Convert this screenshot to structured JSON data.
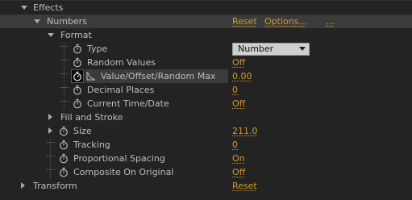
{
  "effects": {
    "label": "Effects",
    "numbers": {
      "label": "Numbers",
      "reset": "Reset",
      "options": "Options...",
      "more": "...",
      "format": {
        "label": "Format",
        "type": {
          "label": "Type",
          "value": "Number"
        },
        "random_values": {
          "label": "Random Values",
          "value": "Off"
        },
        "value_offset": {
          "label": "Value/Offset/Random Max",
          "value": "0.00"
        },
        "decimal_places": {
          "label": "Decimal Places",
          "value": "0"
        },
        "current_time": {
          "label": "Current Time/Date",
          "value": "Off"
        }
      },
      "fill_and_stroke": {
        "label": "Fill and Stroke"
      },
      "size": {
        "label": "Size",
        "value": "211.0"
      },
      "tracking": {
        "label": "Tracking",
        "value": "0"
      },
      "proportional_spacing": {
        "label": "Proportional Spacing",
        "value": "On"
      },
      "composite_on_original": {
        "label": "Composite On Original",
        "value": "Off"
      }
    }
  },
  "transform": {
    "label": "Transform",
    "reset": "Reset"
  },
  "icons": {
    "stopwatch": "stopwatch-icon",
    "graph": "graph-icon",
    "twirl_open": "twirl-down-icon",
    "twirl_closed": "twirl-right-icon"
  },
  "colors": {
    "background": "#232323",
    "highlight_row": "#3b3b3b",
    "value": "#d39a2e",
    "label": "#bdbdbd"
  }
}
